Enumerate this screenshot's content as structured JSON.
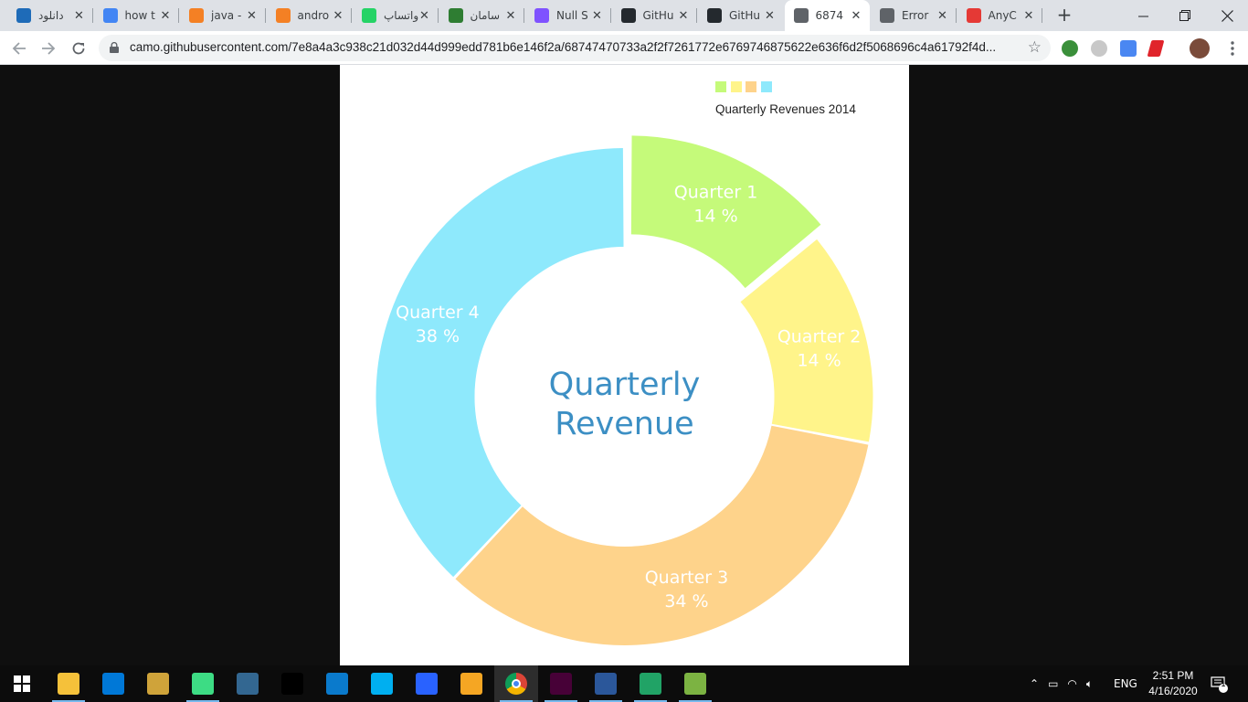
{
  "browser": {
    "tabs": [
      {
        "label": "دانلود",
        "icon": "site-icon",
        "color": "#1e6bb8"
      },
      {
        "label": "how t",
        "icon": "google-icon",
        "color": "#4285f4"
      },
      {
        "label": "java -",
        "icon": "stackoverflow-icon",
        "color": "#f48024"
      },
      {
        "label": "andro",
        "icon": "stackoverflow-icon",
        "color": "#f48024"
      },
      {
        "label": "واتساپ",
        "icon": "whatsapp-icon",
        "color": "#25d366"
      },
      {
        "label": "سامان",
        "icon": "site-icon",
        "color": "#2e7d32"
      },
      {
        "label": "Null S",
        "icon": "kotlin-icon",
        "color": "#7f52ff"
      },
      {
        "label": "GitHu",
        "icon": "github-icon",
        "color": "#24292e"
      },
      {
        "label": "GitHu",
        "icon": "github-icon",
        "color": "#24292e"
      },
      {
        "label": "6874",
        "icon": "globe-icon",
        "color": "#5f6368",
        "active": true
      },
      {
        "label": "Error",
        "icon": "globe-icon",
        "color": "#5f6368"
      },
      {
        "label": "AnyC",
        "icon": "chart-icon",
        "color": "#e53935"
      }
    ],
    "url": "camo.githubusercontent.com/7e8a4a3c938c21d032d44d999edd781b6e146f2a/68747470733a2f2f7261772e6769746875622e636f6d2f5068696c4a61792f4d..."
  },
  "chart_data": {
    "type": "pie",
    "style": "donut",
    "title": "Quarterly Revenue",
    "legend_title": "Quarterly Revenues 2014",
    "legend_position": "top-right",
    "series": [
      {
        "name": "Quarter 1",
        "value": 14,
        "label": "14 %",
        "color": "#c5fa7a",
        "exploded": true
      },
      {
        "name": "Quarter 2",
        "value": 14,
        "label": "14 %",
        "color": "#fff48a"
      },
      {
        "name": "Quarter 3",
        "value": 34,
        "label": "34 %",
        "color": "#fed38b"
      },
      {
        "name": "Quarter 4",
        "value": 38,
        "label": "38 %",
        "color": "#8ee9fc"
      }
    ]
  },
  "taskbar": {
    "apps": [
      "windows-start-icon",
      "file-explorer-icon",
      "mail-icon",
      "app-icon",
      "android-studio-icon",
      "postgresql-icon",
      "intellij-icon",
      "vscode-icon",
      "skype-icon",
      "app-icon",
      "app-icon",
      "chrome-icon",
      "adobe-xd-icon",
      "word-icon",
      "app-icon",
      "app-icon"
    ],
    "language": "ENG",
    "time": "2:51 PM",
    "date": "4/16/2020",
    "notification_count": "1"
  }
}
